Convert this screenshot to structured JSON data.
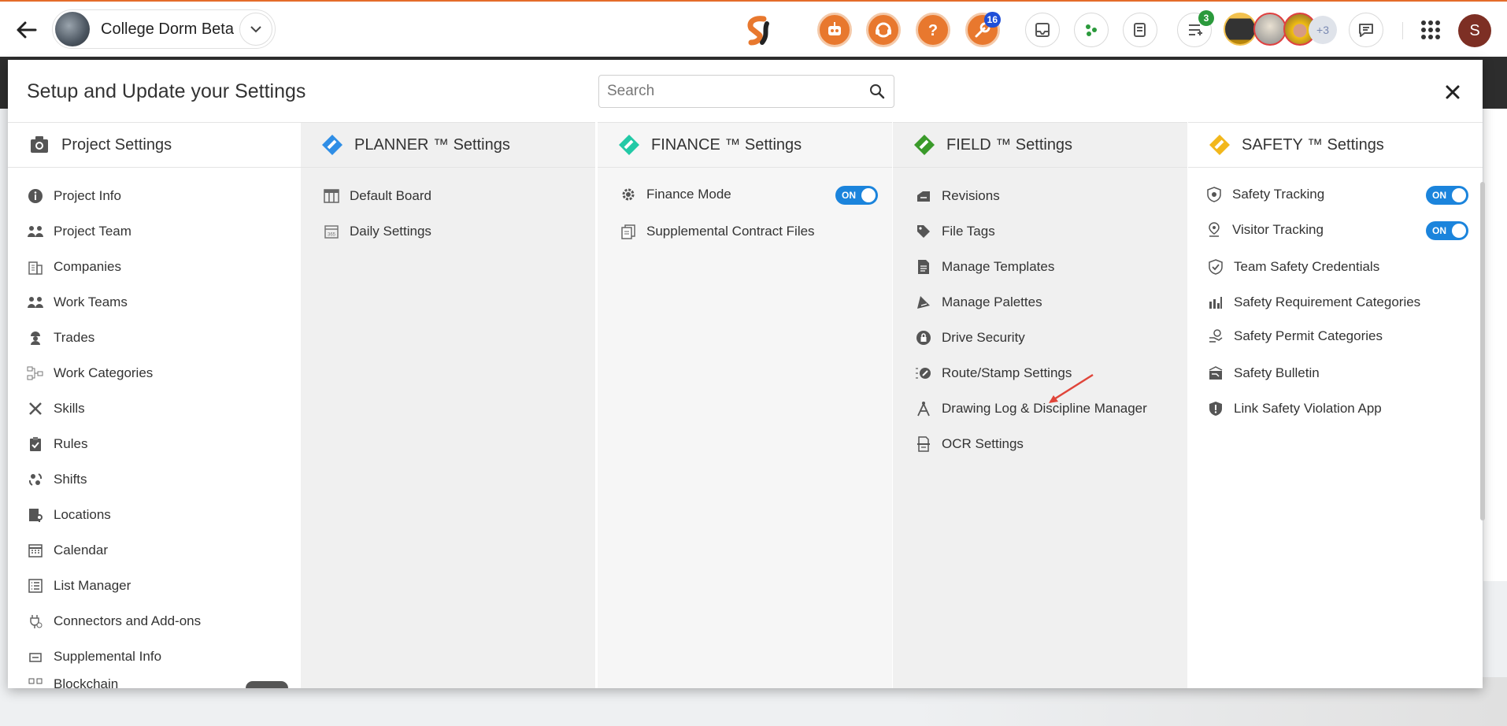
{
  "header": {
    "project_name": "College Dorm Beta",
    "badges": {
      "tools": "16",
      "tasks": "3",
      "more_users": "+3"
    },
    "user_initial": "S"
  },
  "modal": {
    "title": "Setup and Update your Settings",
    "search_placeholder": "Search"
  },
  "columns": [
    {
      "title": "Project Settings",
      "items": [
        "Project Info",
        "Project Team",
        "Companies",
        "Work Teams",
        "Trades",
        "Work Categories",
        "Skills",
        "Rules",
        "Shifts",
        "Locations",
        "Calendar",
        "List Manager",
        "Connectors and Add-ons",
        "Supplemental Info",
        "Blockchain"
      ]
    },
    {
      "title": "PLANNER ™ Settings",
      "items": [
        "Default Board",
        "Daily Settings"
      ]
    },
    {
      "title": "FINANCE ™ Settings",
      "items": [
        "Finance Mode",
        "Supplemental Contract Files"
      ]
    },
    {
      "title": "FIELD ™ Settings",
      "items": [
        "Revisions",
        "File Tags",
        "Manage Templates",
        "Manage Palettes",
        "Drive Security",
        "Route/Stamp Settings",
        "Drawing Log & Discipline Manager",
        "OCR Settings"
      ]
    },
    {
      "title": "SAFETY ™ Settings",
      "items": [
        "Safety Tracking",
        "Visitor Tracking",
        "Team Safety Credentials",
        "Safety Requirement Categories",
        "Safety Permit Categories",
        "Safety Bulletin",
        "Link Safety Violation App"
      ]
    }
  ],
  "toggles": {
    "on_label": "ON"
  },
  "colors": {
    "accent_orange": "#e8782e",
    "toggle_blue": "#1b84dc",
    "planner_blue": "#2f8ee6",
    "finance_teal": "#22c9a6",
    "field_green": "#3a9a2a",
    "safety_yellow": "#f2b71c"
  }
}
